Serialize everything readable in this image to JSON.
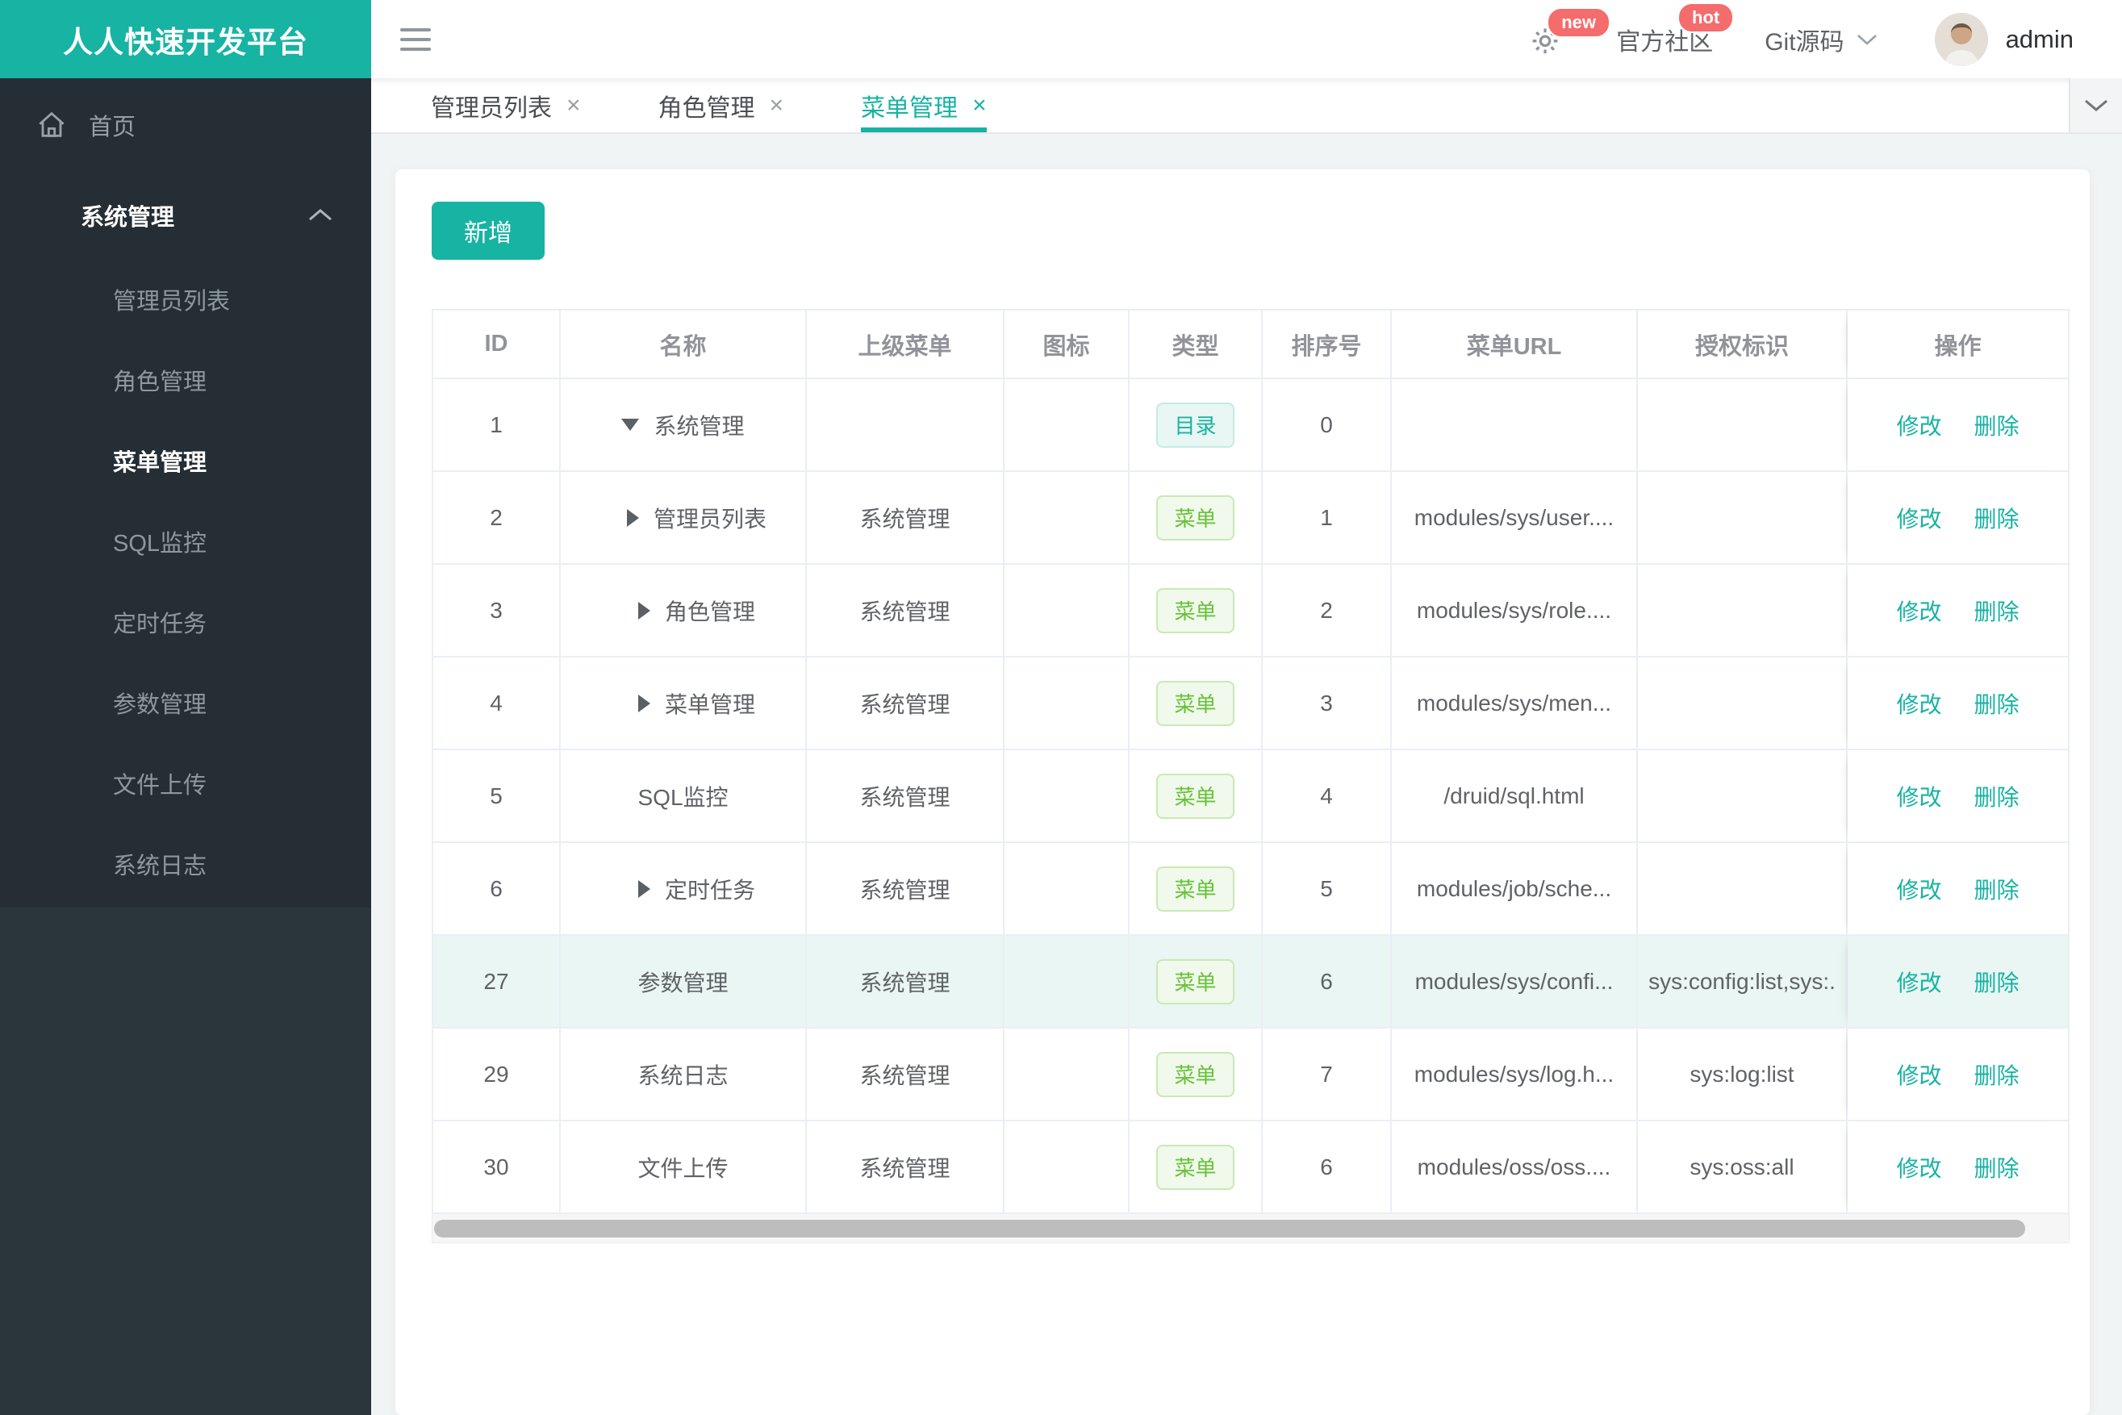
{
  "brand": {
    "title": "人人快速开发平台",
    "accent_color": "#17b3a3"
  },
  "topbar": {
    "new_badge": "new",
    "hot_badge": "hot",
    "community_label": "官方社区",
    "git_label": "Git源码",
    "username": "admin"
  },
  "sidebar": {
    "home_label": "首页",
    "group_label": "系统管理",
    "items": [
      {
        "label": "管理员列表",
        "active": false
      },
      {
        "label": "角色管理",
        "active": false
      },
      {
        "label": "菜单管理",
        "active": true
      },
      {
        "label": "SQL监控",
        "active": false
      },
      {
        "label": "定时任务",
        "active": false
      },
      {
        "label": "参数管理",
        "active": false
      },
      {
        "label": "文件上传",
        "active": false
      },
      {
        "label": "系统日志",
        "active": false
      }
    ]
  },
  "tabs": [
    {
      "label": "管理员列表",
      "close": "×",
      "active": false
    },
    {
      "label": "角色管理",
      "close": "×",
      "active": false
    },
    {
      "label": "菜单管理",
      "close": "×",
      "active": true
    }
  ],
  "toolbar": {
    "add_label": "新增"
  },
  "table": {
    "columns": [
      "ID",
      "名称",
      "上级菜单",
      "图标",
      "类型",
      "排序号",
      "菜单URL",
      "授权标识",
      "操作"
    ],
    "type_labels": {
      "dir": "目录",
      "menu": "菜单"
    },
    "actions": {
      "edit": "修改",
      "delete": "删除"
    },
    "rows": [
      {
        "id": "1",
        "arrow": "down",
        "name": "系统管理",
        "parent": "",
        "icon": "",
        "type": "dir",
        "order": "0",
        "url": "",
        "perm": "",
        "highlight": false
      },
      {
        "id": "2",
        "arrow": "right",
        "name": "管理员列表",
        "parent": "系统管理",
        "icon": "",
        "type": "menu",
        "order": "1",
        "url": "modules/sys/user....",
        "perm": "",
        "highlight": false
      },
      {
        "id": "3",
        "arrow": "right",
        "name": "角色管理",
        "parent": "系统管理",
        "icon": "",
        "type": "menu",
        "order": "2",
        "url": "modules/sys/role....",
        "perm": "",
        "highlight": false
      },
      {
        "id": "4",
        "arrow": "right",
        "name": "菜单管理",
        "parent": "系统管理",
        "icon": "",
        "type": "menu",
        "order": "3",
        "url": "modules/sys/men...",
        "perm": "",
        "highlight": false
      },
      {
        "id": "5",
        "arrow": "none",
        "name": "SQL监控",
        "parent": "系统管理",
        "icon": "",
        "type": "menu",
        "order": "4",
        "url": "/druid/sql.html",
        "perm": "",
        "highlight": false
      },
      {
        "id": "6",
        "arrow": "right",
        "name": "定时任务",
        "parent": "系统管理",
        "icon": "",
        "type": "menu",
        "order": "5",
        "url": "modules/job/sche...",
        "perm": "",
        "highlight": false
      },
      {
        "id": "27",
        "arrow": "none",
        "name": "参数管理",
        "parent": "系统管理",
        "icon": "",
        "type": "menu",
        "order": "6",
        "url": "modules/sys/confi...",
        "perm": "sys:config:list,sys:.",
        "highlight": true
      },
      {
        "id": "29",
        "arrow": "none",
        "name": "系统日志",
        "parent": "系统管理",
        "icon": "",
        "type": "menu",
        "order": "7",
        "url": "modules/sys/log.h...",
        "perm": "sys:log:list",
        "highlight": false
      },
      {
        "id": "30",
        "arrow": "none",
        "name": "文件上传",
        "parent": "系统管理",
        "icon": "",
        "type": "menu",
        "order": "6",
        "url": "modules/oss/oss....",
        "perm": "sys:oss:all",
        "highlight": false
      }
    ]
  }
}
